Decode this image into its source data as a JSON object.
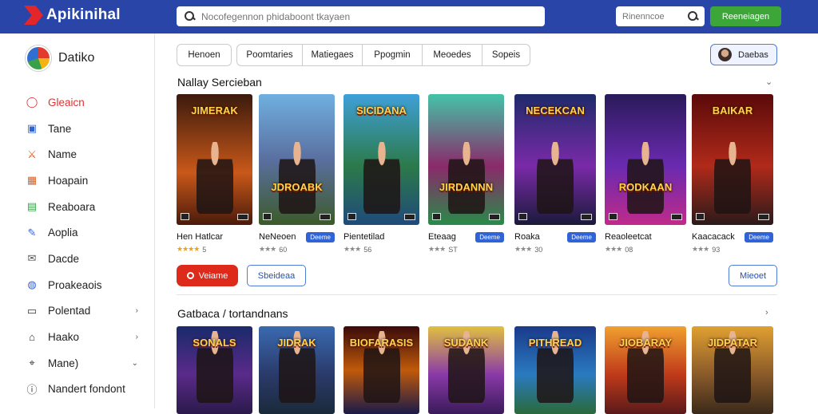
{
  "header": {
    "brand": "Apikinihal",
    "search_placeholder": "Nocofegennon phidaboont tkayaen",
    "search2_placeholder": "Rinenncoe",
    "signup_label": "Reeneiagen"
  },
  "sidebar": {
    "user_name": "Datiko",
    "items": [
      {
        "label": "Gleaicn",
        "icon": "circle-icon",
        "color": "#d33"
      },
      {
        "label": "Tane",
        "icon": "monitor-icon",
        "color": "#2f63d6"
      },
      {
        "label": "Name",
        "icon": "swords-icon",
        "color": "#e55a1c"
      },
      {
        "label": "Hoapain",
        "icon": "gamepad-icon",
        "color": "#e55a1c"
      },
      {
        "label": "Reaboara",
        "icon": "store-icon",
        "color": "#3aa14a"
      },
      {
        "label": "Aoplia",
        "icon": "edit-icon",
        "color": "#2f63d6"
      },
      {
        "label": "Dacde",
        "icon": "mail-icon",
        "color": "#555"
      },
      {
        "label": "Proakeaois",
        "icon": "globe-icon",
        "color": "#2f63d6"
      },
      {
        "label": "Polentad",
        "icon": "card-icon",
        "color": "#333",
        "chev": "›"
      },
      {
        "label": "Haako",
        "icon": "tag-icon",
        "color": "#333",
        "chev": "›"
      },
      {
        "label": "Mane)",
        "icon": "pin-icon",
        "color": "#333",
        "chev": "⌄"
      },
      {
        "label": "Nandert fondont",
        "icon": "info-icon",
        "color": "#333"
      }
    ]
  },
  "tabs": [
    "Henoen",
    "Poomtaries",
    "Matiegaes",
    "Ppogmin",
    "Meoedes",
    "Sopeis"
  ],
  "profile_button": "Daebas",
  "section1": {
    "title": "Nallay Sercieban",
    "cards": [
      {
        "title": "Hen Hatlcar",
        "tag": "",
        "stars": "★★★★",
        "score": "5",
        "cover_title": "JIMERAK",
        "bg": "linear-gradient(180deg,#3b1a0c,#c9581a 60%,#4a1a0a)"
      },
      {
        "title": "NeNeoen",
        "tag": "Deeme",
        "stars": "★★★",
        "score": "60",
        "cover_title": "JDROABK",
        "bg": "linear-gradient(180deg,#6fb0e0,#5a6fa0 50%,#3c5a2a)"
      },
      {
        "title": "Pientetilad",
        "tag": "",
        "stars": "★★★",
        "score": "56",
        "cover_title": "SICIDANA",
        "bg": "linear-gradient(180deg,#3fa0d8,#2c7a4a 55%,#1f4a7a)"
      },
      {
        "title": "Eteaag",
        "tag": "Deeme",
        "stars": "★★★",
        "score": "ST",
        "cover_title": "JIRDANNN",
        "bg": "linear-gradient(180deg,#44c3a8,#8a2a6a 55%,#2a8a4a)"
      },
      {
        "title": "Roaka",
        "tag": "Deeme",
        "stars": "★★★",
        "score": "30",
        "cover_title": "NECEKCAN",
        "bg": "linear-gradient(180deg,#1e2a6a,#7a2aa8 55%,#1a1a3a)"
      },
      {
        "title": "Reaoleetcat",
        "tag": "",
        "stars": "★★★",
        "score": "08",
        "cover_title": "RODKAAN",
        "bg": "linear-gradient(180deg,#2a1a5a,#6a2ab0 55%,#c02a8a)"
      },
      {
        "title": "Kaacacack",
        "tag": "Deeme",
        "stars": "★★★",
        "score": "93",
        "cover_title": "BAIKAR",
        "bg": "linear-gradient(180deg,#5a0a0a,#b02a1a 55%,#2a1a1a)"
      }
    ]
  },
  "buttons": {
    "red": "Veiame",
    "outline": "Sbeideaa",
    "more": "Mieoet"
  },
  "section2": {
    "title": "Gatbaca / tortandnans",
    "cards": [
      {
        "cover_title": "SONALS",
        "bg": "linear-gradient(180deg,#1a2a6a,#5a2a8a 55%,#2a1a4a)"
      },
      {
        "cover_title": "JIDRAK",
        "bg": "linear-gradient(180deg,#3a6ab0,#2a3a6a 55%,#1a2a3a)"
      },
      {
        "cover_title": "BIOFARASIS",
        "bg": "linear-gradient(180deg,#3a0a0a,#c05a0a 50%,#1a1a4a)"
      },
      {
        "cover_title": "SUDANK",
        "bg": "linear-gradient(180deg,#e0c040,#8a3aa8 55%,#3a1a5a)"
      },
      {
        "cover_title": "PITHREAD",
        "bg": "linear-gradient(180deg,#1a3a8a,#2a7ac0 55%,#2a6a3a)"
      },
      {
        "cover_title": "JIOBARAY",
        "bg": "linear-gradient(180deg,#f0a030,#c03a1a 55%,#5a1a1a)"
      },
      {
        "cover_title": "JIDPATAR",
        "bg": "linear-gradient(180deg,#e0a030,#8a5a2a 55%,#3a2a1a)"
      }
    ]
  }
}
